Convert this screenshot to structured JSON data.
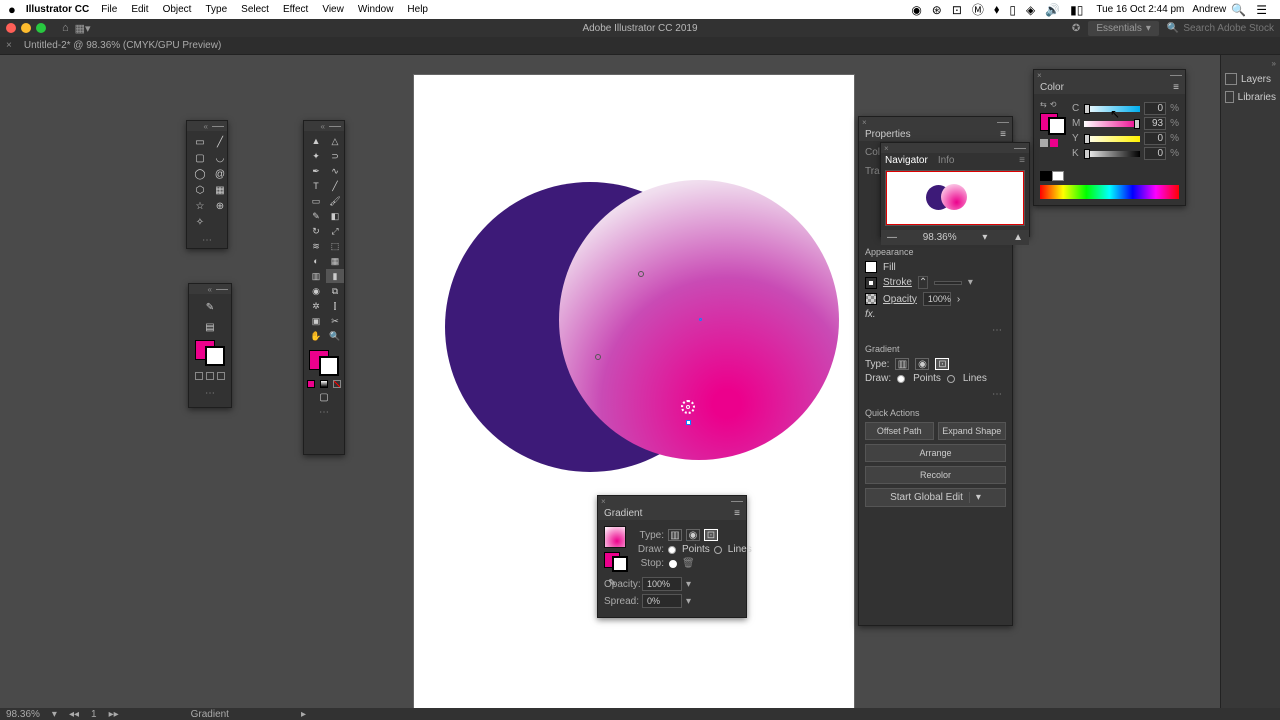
{
  "menubar": {
    "app": "Illustrator CC",
    "items": [
      "File",
      "Edit",
      "Object",
      "Type",
      "Select",
      "Effect",
      "View",
      "Window",
      "Help"
    ],
    "datetime": "Tue 16 Oct  2:44 pm",
    "user": "Andrew"
  },
  "appbar": {
    "title": "Adobe Illustrator CC 2019",
    "workspace": "Essentials",
    "search_placeholder": "Search Adobe Stock"
  },
  "doc_tab": "Untitled-2* @ 98.36% (CMYK/GPU Preview)",
  "statusbar": {
    "zoom": "98.36%",
    "page": "1",
    "tool": "Gradient"
  },
  "gradient_panel": {
    "title": "Gradient",
    "type_label": "Type:",
    "draw_label": "Draw:",
    "draw_points": "Points",
    "draw_lines": "Lines",
    "stop_label": "Stop:",
    "opacity_label": "Opacity:",
    "opacity_value": "100%",
    "spread_label": "Spread:",
    "spread_value": "0%"
  },
  "properties": {
    "title": "Properties",
    "tabs": [
      "Color",
      "Transf"
    ],
    "appearance": {
      "header": "Appearance",
      "fill": "Fill",
      "stroke": "Stroke",
      "stroke_weight": "",
      "opacity": "Opacity",
      "opacity_value": "100%"
    },
    "gradient": {
      "header": "Gradient",
      "type_label": "Type:",
      "draw_label": "Draw:",
      "points": "Points",
      "lines": "Lines"
    },
    "quick": {
      "header": "Quick Actions",
      "offset": "Offset Path",
      "expand": "Expand Shape",
      "arrange": "Arrange",
      "recolor": "Recolor",
      "global_edit": "Start Global Edit"
    }
  },
  "navigator": {
    "tab1": "Navigator",
    "tab2": "Info",
    "zoom": "98.36%"
  },
  "color_panel": {
    "title": "Color",
    "channels": [
      {
        "label": "C",
        "value": "0"
      },
      {
        "label": "M",
        "value": "93"
      },
      {
        "label": "Y",
        "value": "0"
      },
      {
        "label": "K",
        "value": "0"
      }
    ],
    "pct": "%"
  },
  "dock": {
    "layers": "Layers",
    "libraries": "Libraries"
  }
}
